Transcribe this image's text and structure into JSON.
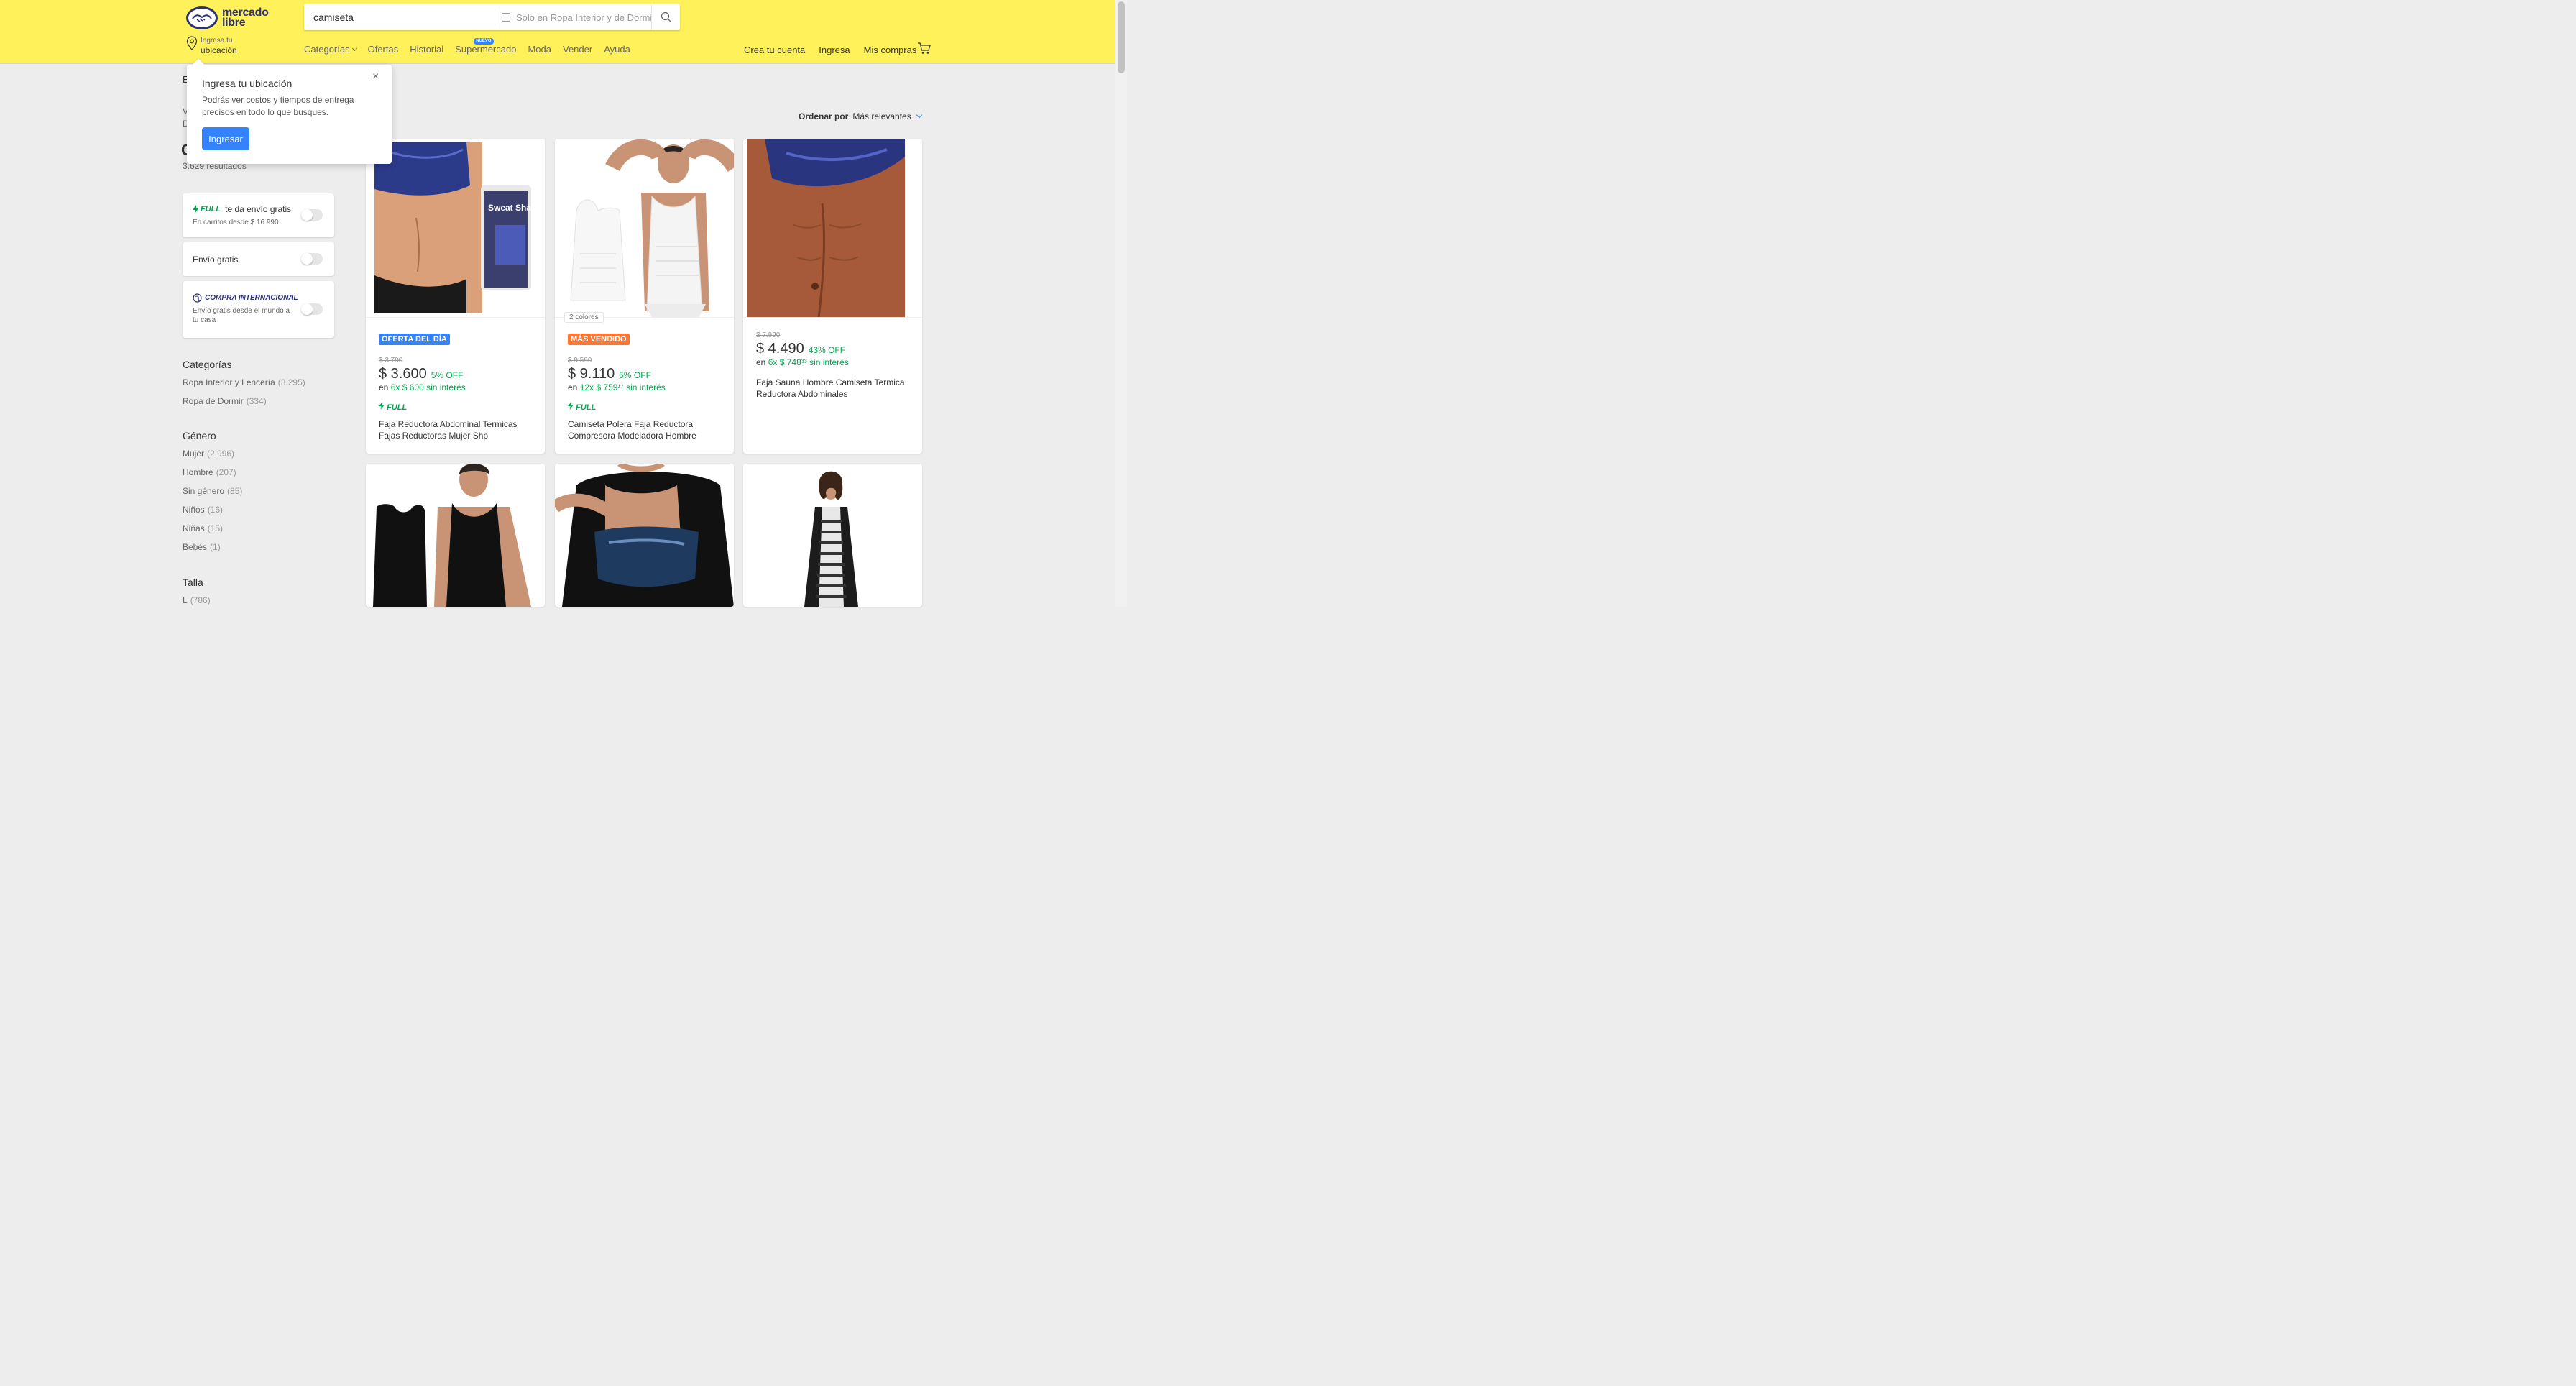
{
  "header": {
    "logo_line1": "mercado",
    "logo_line2": "libre",
    "search_value": "camiseta",
    "search_filter": "Solo en Ropa Interior y de Dormir",
    "location_small": "Ingresa tu",
    "location_big": "ubicación",
    "nav": [
      "Categorías",
      "Ofertas",
      "Historial",
      "Supermercado",
      "Moda",
      "Vender",
      "Ayuda"
    ],
    "nav_badge": "NUEVO",
    "user_nav": [
      "Crea tu cuenta",
      "Ingresa",
      "Mis compras"
    ]
  },
  "popover": {
    "title": "Ingresa tu ubicación",
    "text": "Podrás ver costos y tiempos de entrega precisos en todo lo que busques.",
    "button": "Ingresar",
    "close": "×"
  },
  "sidebar": {
    "results": "3.629 resultados",
    "full_filter": {
      "tag": "FULL",
      "label": "te da envío gratis",
      "sub": "En carritos desde $ 16.990"
    },
    "free_shipping": "Envío gratis",
    "international": {
      "tag": "COMPRA INTERNACIONAL",
      "sub": "Envío gratis desde el mundo a tu casa"
    },
    "categories_title": "Categorías",
    "categories": [
      {
        "label": "Ropa Interior y Lencería",
        "count": "(3.295)"
      },
      {
        "label": "Ropa de Dormir",
        "count": "(334)"
      }
    ],
    "gender_title": "Género",
    "genders": [
      {
        "label": "Mujer",
        "count": "(2.996)"
      },
      {
        "label": "Hombre",
        "count": "(207)"
      },
      {
        "label": "Sin género",
        "count": "(85)"
      },
      {
        "label": "Niños",
        "count": "(16)"
      },
      {
        "label": "Niñas",
        "count": "(15)"
      },
      {
        "label": "Bebés",
        "count": "(1)"
      }
    ],
    "size_title": "Talla",
    "sizes": [
      {
        "label": "L",
        "count": "(786)"
      }
    ]
  },
  "sort": {
    "label": "Ordenar por",
    "value": "Más relevantes"
  },
  "products": [
    {
      "tag": "OFERTA DEL DÍA",
      "tag_color": "#3483fa",
      "old_price": "$ 3.790",
      "price": "$ 3.600",
      "off": "5% OFF",
      "inst_prefix": "en",
      "inst": "6x $ 600 sin interés",
      "full": "FULL",
      "title": "Faja Reductora Abdominal Termicas Fajas Reductoras Mujer Shp"
    },
    {
      "tag": "MÁS VENDIDO",
      "tag_color": "#ff7733",
      "colors": "2 colores",
      "old_price": "$ 9.590",
      "price": "$ 9.110",
      "off": "5% OFF",
      "inst_prefix": "en",
      "inst": "12x $ 759¹⁷ sin interés",
      "full": "FULL",
      "title": "Camiseta Polera Faja Reductora Compresora Modeladora Hombre"
    },
    {
      "old_price": "$ 7.990",
      "price": "$ 4.490",
      "off": "43% OFF",
      "inst_prefix": "en",
      "inst": "6x $ 748³³ sin interés",
      "title": "Faja Sauna Hombre Camiseta Termica Reductora Abdominales"
    }
  ],
  "image_labels": {
    "sweat_shaper": "Sweat Shaper"
  }
}
